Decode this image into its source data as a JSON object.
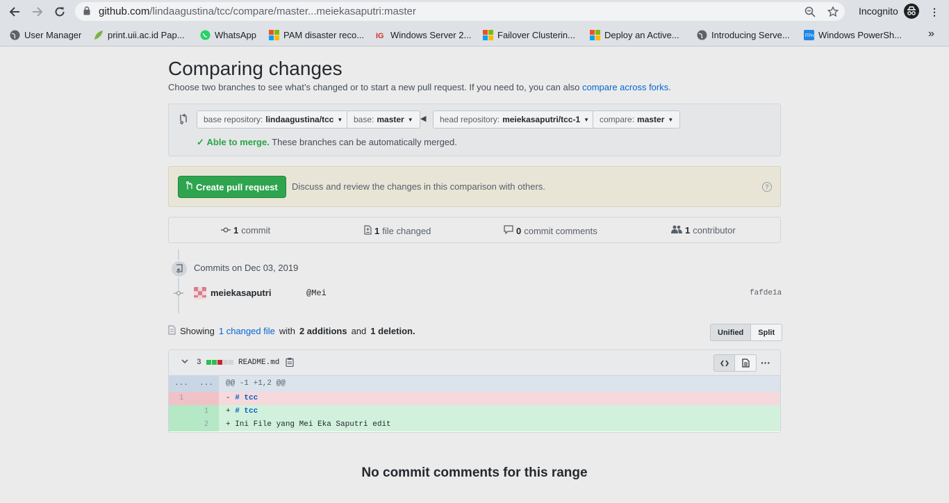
{
  "browser": {
    "url_main": "github.com",
    "url_path": "/lindaagustina/tcc/compare/master...meiekasaputri:master",
    "incognito_label": "Incognito",
    "bookmarks": [
      {
        "label": "User Manager",
        "icon": "globe-icon",
        "color": "#5f6368"
      },
      {
        "label": "print.uii.ac.id Pap...",
        "icon": "leaf-icon",
        "color": "#7cb342"
      },
      {
        "label": "WhatsApp",
        "icon": "whatsapp-icon",
        "color": "#25d366"
      },
      {
        "label": "PAM disaster reco...",
        "icon": "microsoft-icon",
        "color": "#f25022"
      },
      {
        "label": "Windows Server 2...",
        "icon": "ig-icon",
        "color": "#d32f2f"
      },
      {
        "label": "Failover Clusterin...",
        "icon": "microsoft-icon",
        "color": "#f25022"
      },
      {
        "label": "Deploy an Active...",
        "icon": "microsoft-icon",
        "color": "#f25022"
      },
      {
        "label": "Introducing Serve...",
        "icon": "globe-icon",
        "color": "#5f6368"
      },
      {
        "label": "Windows PowerSh...",
        "icon": "itpro-icon",
        "color": "#1e88e5"
      }
    ],
    "bookmarks_more": "»"
  },
  "page": {
    "title": "Comparing changes",
    "subtitle": "Choose two branches to see what’s changed or to start a new pull request. If you need to, you can also",
    "subtitle_link": "compare across forks."
  },
  "range": {
    "base_repo_label": "base repository:",
    "base_repo_value": "lindaagustina/tcc",
    "base_label": "base:",
    "base_value": "master",
    "head_repo_label": "head repository:",
    "head_repo_value": "meiekasaputri/tcc-1",
    "compare_label": "compare:",
    "compare_value": "master",
    "merge_ok": "Able to merge.",
    "merge_text": "These branches can be automatically merged."
  },
  "pr": {
    "button_label": "Create pull request",
    "description": "Discuss and review the changes in this comparison with others."
  },
  "stats": {
    "commits_count": "1",
    "commits_label": "commit",
    "files_count": "1",
    "files_label": "file changed",
    "comments_count": "0",
    "comments_label": "commit comments",
    "contributors_count": "1",
    "contributors_label": "contributor"
  },
  "commits": {
    "date_heading": "Commits on Dec 03, 2019",
    "items": [
      {
        "author": "meiekasaputri",
        "message": "@Mei",
        "sha": "fafde1a"
      }
    ]
  },
  "diff_summary": {
    "prefix": "Showing",
    "link": "1 changed file",
    "mid": "with",
    "additions": "2 additions",
    "and": "and",
    "deletions": "1 deletion."
  },
  "view_toggle": {
    "unified": "Unified",
    "split": "Split"
  },
  "file": {
    "change_count": "3",
    "name": "README.md",
    "diffstat_colors": [
      "#2cbe4e",
      "#2cbe4e",
      "#cb2431",
      "#d1d5da",
      "#d1d5da"
    ],
    "lines": [
      {
        "type": "hunk",
        "ln1": "...",
        "ln2": "...",
        "sign": "",
        "code": "@@ -1 +1,2 @@"
      },
      {
        "type": "del",
        "ln1": "1",
        "ln2": "",
        "sign": "- ",
        "code": "# tcc"
      },
      {
        "type": "add",
        "ln1": "",
        "ln2": "1",
        "sign": "+ ",
        "code": "# tcc"
      },
      {
        "type": "add",
        "ln1": "",
        "ln2": "2",
        "sign": "+ ",
        "code": "Ini File yang Mei Eka Saputri edit"
      }
    ]
  },
  "footer": {
    "no_comments": "No commit comments for this range"
  }
}
